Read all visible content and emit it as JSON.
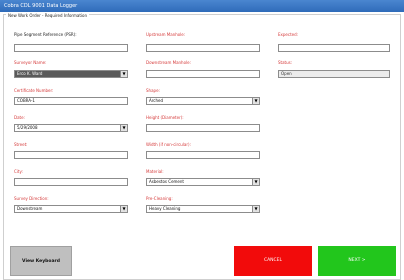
{
  "window": {
    "title": "Cobra CDL 9001 Data Logger"
  },
  "group_title": "New Work Order - Required Information",
  "fields": {
    "pipe_segment": {
      "label": "Pipe Segment Reference (PSR):",
      "value": ""
    },
    "upstream_manhole": {
      "label": "Upstream Manhole:",
      "value": ""
    },
    "expected": {
      "label": "Expected:",
      "value": ""
    },
    "surveyor_name": {
      "label": "Surveyor Name:",
      "value": "Erco K. Ward"
    },
    "downstream_manhole": {
      "label": "Downstream Manhole:",
      "value": ""
    },
    "status": {
      "label": "Status:",
      "value": "Open"
    },
    "certificate_number": {
      "label": "Certificate Number:",
      "value": "COBRA-1"
    },
    "shape": {
      "label": "Shape:",
      "value": "Arched"
    },
    "date": {
      "label": "Date:",
      "value": "5/29/2008"
    },
    "height": {
      "label": "Height (Diameter):",
      "value": ""
    },
    "street": {
      "label": "Street:",
      "value": ""
    },
    "width": {
      "label": "Width (if non-circular):",
      "value": ""
    },
    "city": {
      "label": "City:",
      "value": ""
    },
    "material": {
      "label": "Material:",
      "value": "Asbestos Cement"
    },
    "survey_direction": {
      "label": "Survey Direction:",
      "value": "Downstream"
    },
    "pre_cleaning": {
      "label": "Pre-Cleaning:",
      "value": "Heavy Cleaning"
    }
  },
  "buttons": {
    "view_keyboard": "View Keyboard",
    "cancel": "CANCEL",
    "next": "NEXT >"
  },
  "colors": {
    "required_label": "#d53a3a",
    "cancel_bg": "#f20b0b",
    "next_bg": "#22c61c",
    "titlebar": "#3a78c6"
  }
}
